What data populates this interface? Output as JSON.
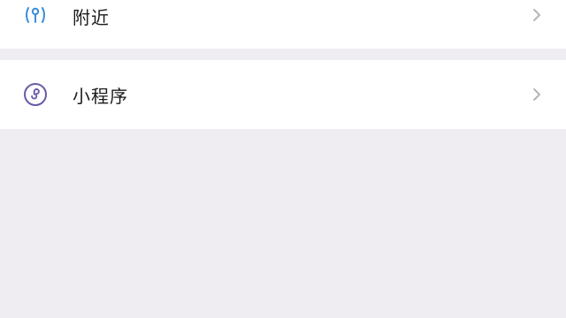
{
  "menu": {
    "items": [
      {
        "id": "nearby",
        "label": "附近",
        "icon": "location-beacon-icon",
        "icon_color": "#3B8FD9"
      },
      {
        "id": "mini_programs",
        "label": "小程序",
        "icon": "mini-program-icon",
        "icon_color": "#6A5AA8"
      }
    ]
  },
  "colors": {
    "background": "#EFEDF2",
    "row_background": "#FFFFFF",
    "text": "#1A1A1A",
    "chevron": "#B5B5B5"
  }
}
